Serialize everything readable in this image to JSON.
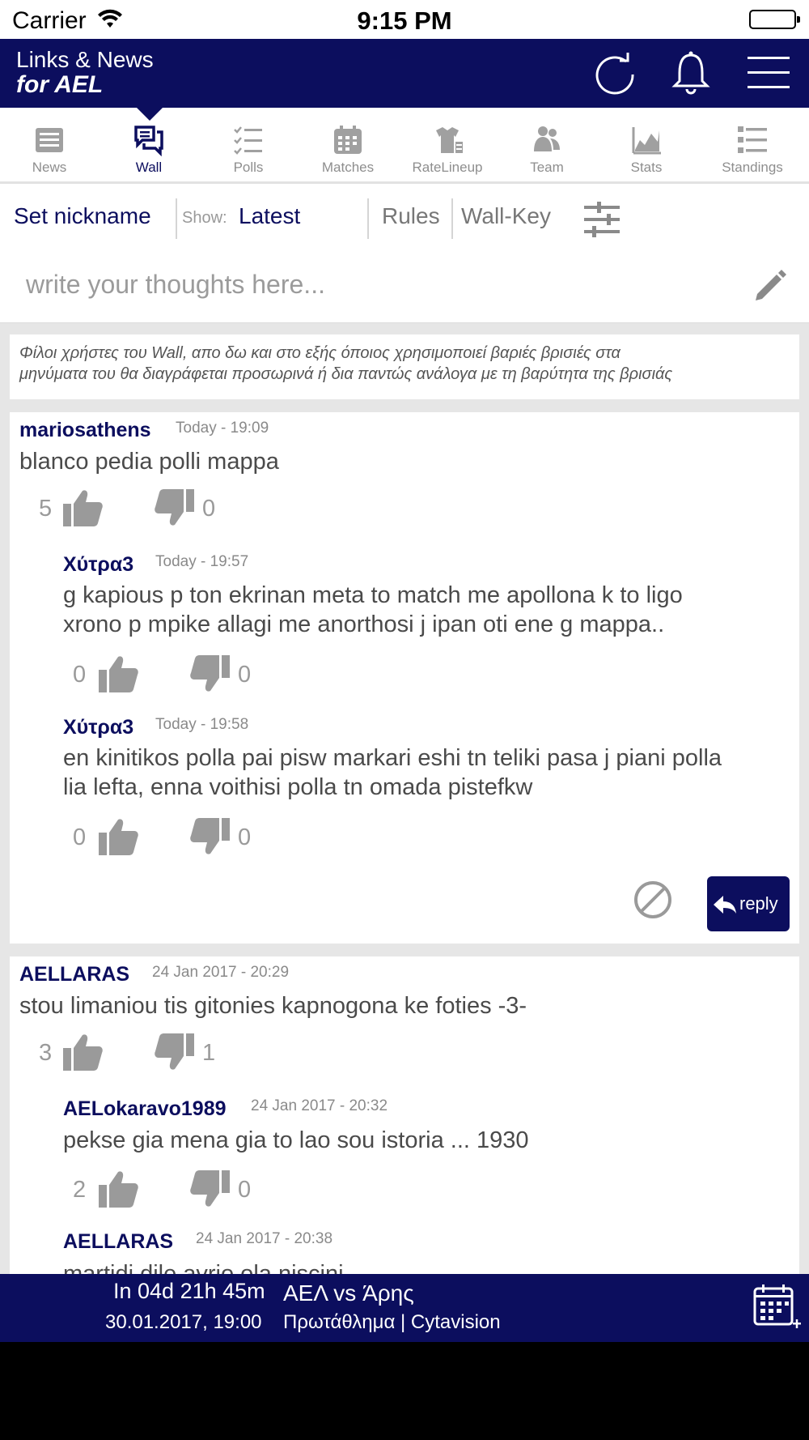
{
  "status_bar": {
    "carrier": "Carrier",
    "time": "9:15 PM"
  },
  "header": {
    "title_line1": "Links & News",
    "title_line2": "for AEL",
    "icons": [
      "refresh-icon",
      "bell-icon",
      "menu-icon"
    ]
  },
  "tabs": [
    {
      "label": "News",
      "icon": "news-icon"
    },
    {
      "label": "Wall",
      "icon": "chat-icon",
      "active": true
    },
    {
      "label": "Polls",
      "icon": "list-check-icon"
    },
    {
      "label": "Matches",
      "icon": "calendar-icon"
    },
    {
      "label": "RateLineup",
      "icon": "shirt-icon"
    },
    {
      "label": "Team",
      "icon": "people-icon"
    },
    {
      "label": "Stats",
      "icon": "chart-icon"
    },
    {
      "label": "Standings",
      "icon": "ranking-icon"
    }
  ],
  "toolbar": {
    "set_nickname": "Set nickname",
    "show_label": "Show:",
    "show_value": "Latest",
    "rules": "Rules",
    "wall_key": "Wall-Key"
  },
  "compose": {
    "placeholder": "write your thoughts here..."
  },
  "notice": {
    "line1": "Φίλοι χρήστες του Wall, απο δω και στο εξής όποιος χρησιμοποιεί βαριές βρισιές στα",
    "line2": "μηνύματα του θα διαγράφεται προσωρινά ή δια παντώς ανάλογα με τη βαρύτητα της βρισιάς"
  },
  "posts": [
    {
      "author": "mariosathens",
      "time": "Today - 19:09",
      "text": "blanco pedia polli mappa",
      "likes": "5",
      "dislikes": "0",
      "replies": [
        {
          "author": "Χύτρα3",
          "time": "Today - 19:57",
          "line1": "g kapious p ton ekrinan meta to match me apollona k to ligo",
          "line2": "xrono p mpike allagi me anorthosi j ipan oti ene g mappa..",
          "likes": "0",
          "dislikes": "0"
        },
        {
          "author": "Χύτρα3",
          "time": "Today - 19:58",
          "line1": "en kinitikos polla pai pisw markari eshi tn teliki pasa j piani polla",
          "line2": "lia lefta, enna voithisi polla tn omada pistefkw",
          "likes": "0",
          "dislikes": "0"
        }
      ],
      "reply_label": "reply"
    },
    {
      "author": "AELLARAS",
      "time": "24 Jan 2017 - 20:29",
      "text": "stou limaniou tis gitonies kapnogona ke foties -3-",
      "likes": "3",
      "dislikes": "1",
      "replies": [
        {
          "author": "AELokaravo1989",
          "time": "24 Jan 2017 - 20:32",
          "line1": "pekse gia mena gia to lao sou istoria ... 1930",
          "likes": "2",
          "dislikes": "0"
        },
        {
          "author": "AELLARAS",
          "time": "24 Jan 2017 - 20:38",
          "line1": "martidi dile avrio ola niscini"
        }
      ]
    }
  ],
  "next_match": {
    "countdown": "In 04d 21h 45m",
    "teams": "ΑΕΛ vs Άρης",
    "datetime": "30.01.2017, 19:00",
    "competition": "Πρωτάθλημα | Cytavision"
  },
  "colors": {
    "brand": "#0c0e5e",
    "muted": "#9a9a9a",
    "feed_bg": "#e6e6e6"
  }
}
